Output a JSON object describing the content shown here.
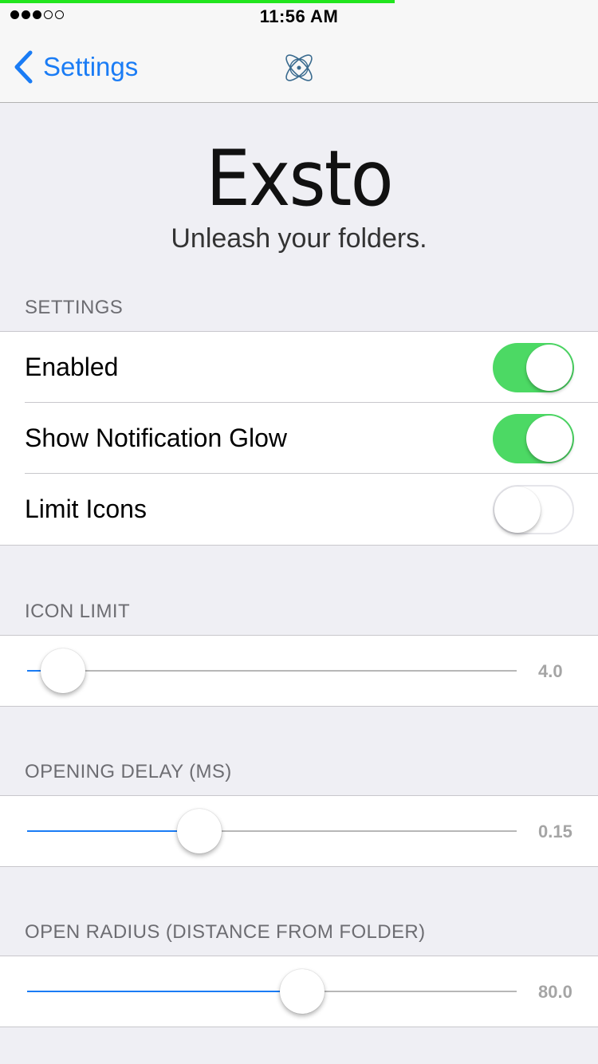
{
  "status_bar": {
    "time": "11:56 AM",
    "signal_dots": [
      true,
      true,
      true,
      false,
      false
    ],
    "load_progress": 0.66
  },
  "nav": {
    "back_label": "Settings",
    "logo_icon": "atom-logo-icon"
  },
  "header": {
    "title": "Exsto",
    "subtitle": "Unleash your folders."
  },
  "settings_section": {
    "label": "SETTINGS",
    "toggles": [
      {
        "label": "Enabled",
        "on": true
      },
      {
        "label": "Show Notification Glow",
        "on": true
      },
      {
        "label": "Limit Icons",
        "on": false
      }
    ]
  },
  "sliders": [
    {
      "label": "ICON LIMIT",
      "value_text": "4.0",
      "fraction": 0.04
    },
    {
      "label": "OPENING DELAY (MS)",
      "value_text": "0.15",
      "fraction": 0.32
    },
    {
      "label": "OPEN RADIUS (DISTANCE FROM FOLDER)",
      "value_text": "80.0",
      "fraction": 0.53
    }
  ],
  "colors": {
    "accent": "#1a7cf5",
    "switch_on": "#4cd964",
    "progress": "#22e51e"
  }
}
